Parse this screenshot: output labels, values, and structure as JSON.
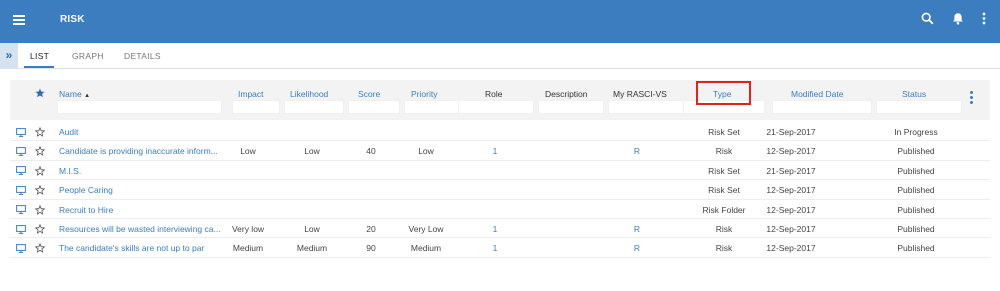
{
  "app": {
    "title": "RISK"
  },
  "tabs": [
    {
      "label": "LIST"
    },
    {
      "label": "GRAPH"
    },
    {
      "label": "DETAILS"
    }
  ],
  "collapse_glyph": "»",
  "columns": {
    "name": "Name",
    "sort_glyph": "▲",
    "impact": "Impact",
    "likelihood": "Likelihood",
    "score": "Score",
    "priority": "Priority",
    "role": "Role",
    "description": "Description",
    "rascivs": "My RASCI-VS",
    "type": "Type",
    "modified": "Modified Date",
    "status": "Status"
  },
  "rows": [
    {
      "name": "Audit",
      "impact": "",
      "likelihood": "",
      "score": "",
      "priority": "",
      "role": "",
      "rascivs": "",
      "type": "Risk Set",
      "modified": "21-Sep-2017",
      "status": "In Progress"
    },
    {
      "name": "Candidate is providing inaccurate inform...",
      "impact": "Low",
      "likelihood": "Low",
      "score": "40",
      "priority": "Low",
      "role": "1",
      "rascivs": "R",
      "type": "Risk",
      "modified": "12-Sep-2017",
      "status": "Published"
    },
    {
      "name": "M.I.S.",
      "impact": "",
      "likelihood": "",
      "score": "",
      "priority": "",
      "role": "",
      "rascivs": "",
      "type": "Risk Set",
      "modified": "21-Sep-2017",
      "status": "Published"
    },
    {
      "name": "People Caring",
      "impact": "",
      "likelihood": "",
      "score": "",
      "priority": "",
      "role": "",
      "rascivs": "",
      "type": "Risk Set",
      "modified": "12-Sep-2017",
      "status": "Published"
    },
    {
      "name": "Recruit to Hire",
      "impact": "",
      "likelihood": "",
      "score": "",
      "priority": "",
      "role": "",
      "rascivs": "",
      "type": "Risk Folder",
      "modified": "12-Sep-2017",
      "status": "Published"
    },
    {
      "name": "Resources will be wasted interviewing ca...",
      "impact": "Very low",
      "likelihood": "Low",
      "score": "20",
      "priority": "Very Low",
      "role": "1",
      "rascivs": "R",
      "type": "Risk",
      "modified": "12-Sep-2017",
      "status": "Published"
    },
    {
      "name": "The candidate's skills are not up to par",
      "impact": "Medium",
      "likelihood": "Medium",
      "score": "90",
      "priority": "Medium",
      "role": "1",
      "rascivs": "R",
      "type": "Risk",
      "modified": "12-Sep-2017",
      "status": "Published"
    }
  ],
  "colors": {
    "topbar": "#3b7dbf",
    "link": "#3b7dbf",
    "highlight": "#e2231a"
  }
}
